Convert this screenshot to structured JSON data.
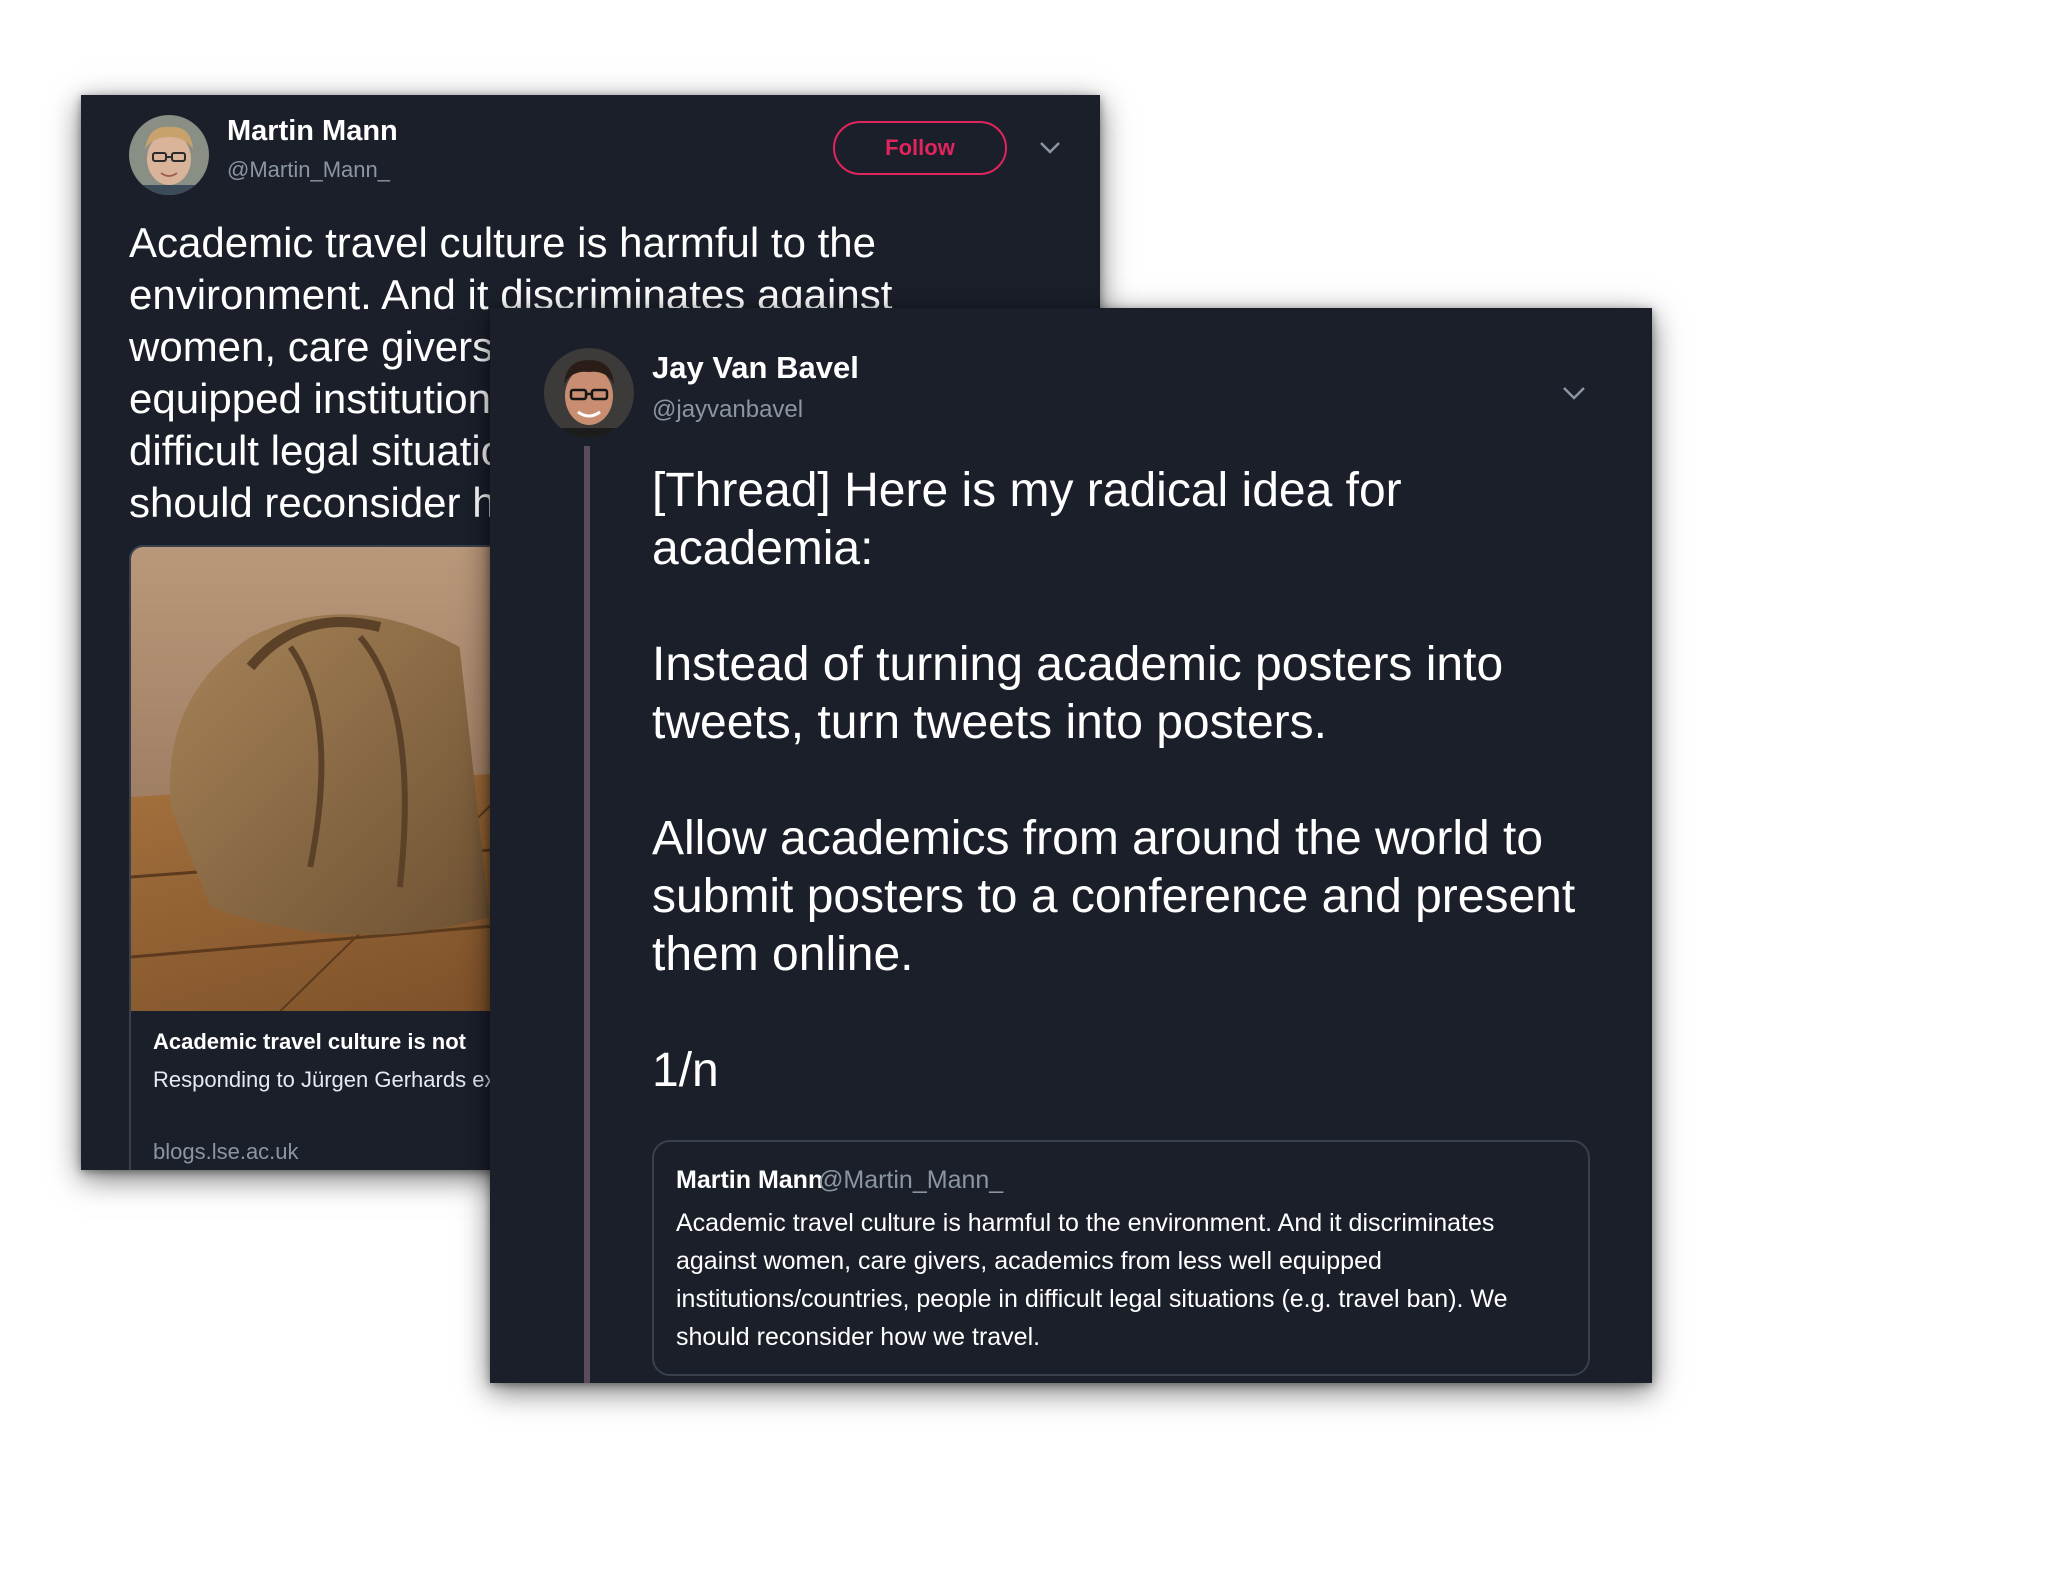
{
  "tweet_back": {
    "author_name": "Martin Mann",
    "author_handle": "@Martin_Mann_",
    "follow_label": "Follow",
    "text": "Academic travel culture is harmful to the environment. And it discriminates against women, care givers, academics from less well equipped institutions/countries, people in difficult legal situations (e.g. travel ban). We should reconsider how we travel.",
    "link_card": {
      "title": "Academic travel culture is not",
      "description": "Responding to Jürgen Gerhards excessive academic travel, Race",
      "domain": "blogs.lse.ac.uk"
    }
  },
  "tweet_front": {
    "author_name": "Jay Van Bavel",
    "author_handle": "@jayvanbavel",
    "paragraphs": [
      "[Thread] Here is my radical idea for academia:",
      "Instead of turning academic posters into tweets, turn tweets into posters.",
      "Allow academics from around the world to submit posters to a conference and present them online.",
      "1/n"
    ],
    "quoted_tweet": {
      "author_name": "Martin Mann",
      "author_handle": "@Martin_Mann_",
      "text": "Academic travel culture is harmful to the environment. And it discriminates against women, care givers, academics from less well equipped institutions/countries, people in difficult legal situations (e.g. travel ban). We should reconsider how we travel."
    }
  },
  "colors": {
    "card_background": "#1b1f2a",
    "follow_accent": "#e0245e",
    "secondary_text": "#8b96a3",
    "thread_line": "#5b4c5c"
  },
  "icons": {
    "tweet_back_menu": "chevron-down-icon",
    "tweet_front_menu": "chevron-down-icon"
  }
}
